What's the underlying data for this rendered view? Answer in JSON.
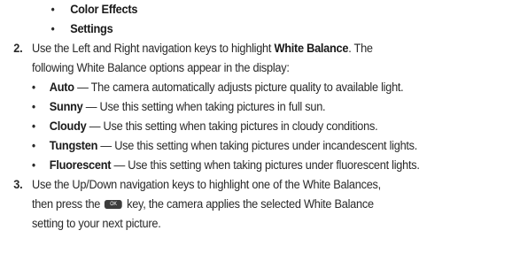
{
  "top_bullets": [
    {
      "text": "Color Effects"
    },
    {
      "text": "Settings"
    }
  ],
  "steps": [
    {
      "number": "2.",
      "line1_prefix": "Use the Left and Right navigation keys to highlight ",
      "line1_bold": "White Balance",
      "line1_suffix": ". The",
      "line2": "following White Balance options appear in the display:",
      "options": [
        {
          "name": "Auto",
          "desc": " — The camera automatically adjusts picture quality to available light."
        },
        {
          "name": "Sunny",
          "desc": " — Use this setting when taking pictures in full sun."
        },
        {
          "name": "Cloudy",
          "desc": " — Use this setting when taking pictures in cloudy conditions."
        },
        {
          "name": "Tungsten",
          "desc": " — Use this setting when taking pictures under incandescent lights."
        },
        {
          "name": "Fluorescent",
          "desc": " — Use this setting when taking pictures under fluorescent lights."
        }
      ]
    },
    {
      "number": "3.",
      "line1": "Use the Up/Down navigation keys to highlight one of the White Balances,",
      "line2_prefix": "then press the ",
      "key_icon": "ok-key-icon",
      "line2_suffix": " key, the camera applies the selected White Balance",
      "line3": "setting to your next picture."
    }
  ],
  "bullet_glyph": "•"
}
